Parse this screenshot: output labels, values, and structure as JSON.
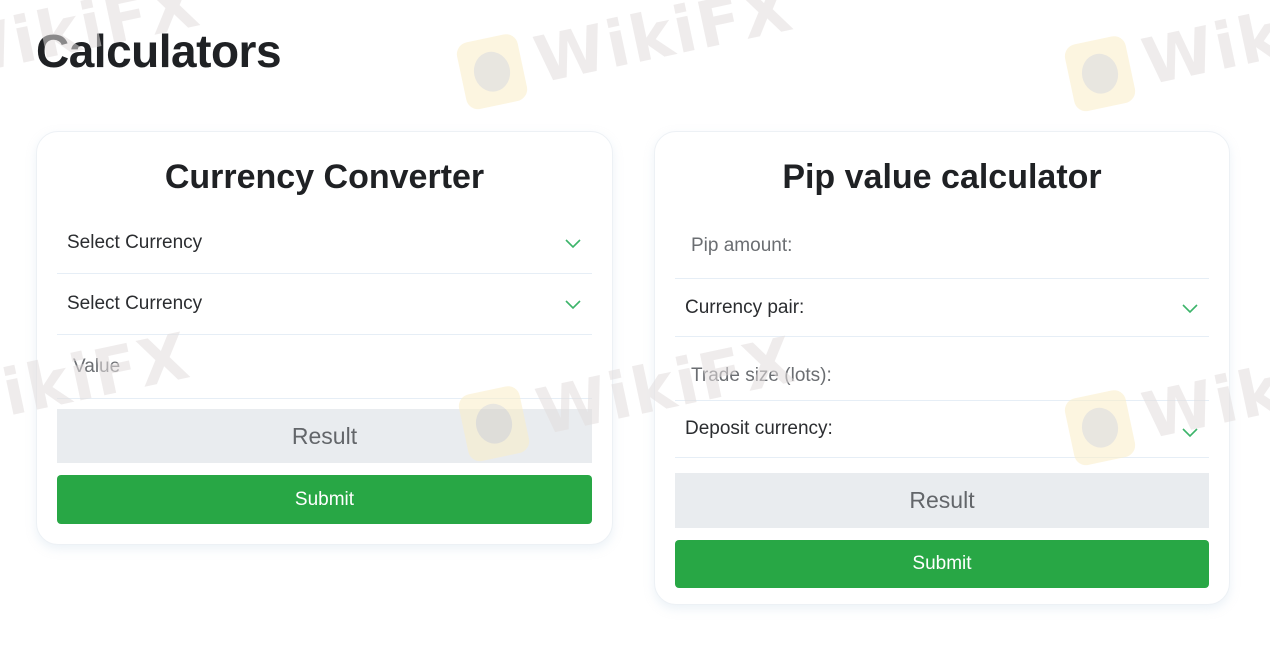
{
  "page": {
    "title": "Calculators"
  },
  "watermark": {
    "text": "WikiFX"
  },
  "currency_converter": {
    "title": "Currency Converter",
    "from_select": {
      "value": "Select Currency",
      "icon": "chevron-down-icon"
    },
    "to_select": {
      "value": "Select Currency",
      "icon": "chevron-down-icon"
    },
    "value_input": {
      "placeholder": "Value",
      "value": ""
    },
    "result": "Result",
    "submit_label": "Submit"
  },
  "pip_calculator": {
    "title": "Pip value calculator",
    "pip_amount_input": {
      "placeholder": "Pip amount:",
      "value": ""
    },
    "currency_pair_select": {
      "value": "Currency pair:",
      "icon": "chevron-down-icon"
    },
    "trade_size_input": {
      "placeholder": "Trade size (lots):",
      "value": ""
    },
    "deposit_currency_select": {
      "value": "Deposit currency:",
      "icon": "chevron-down-icon"
    },
    "result": "Result",
    "submit_label": "Submit"
  },
  "colors": {
    "accent_green": "#28a745",
    "chevron_green": "#3cb46a",
    "result_bg": "#e9ecef",
    "title_text": "#1f2124"
  }
}
